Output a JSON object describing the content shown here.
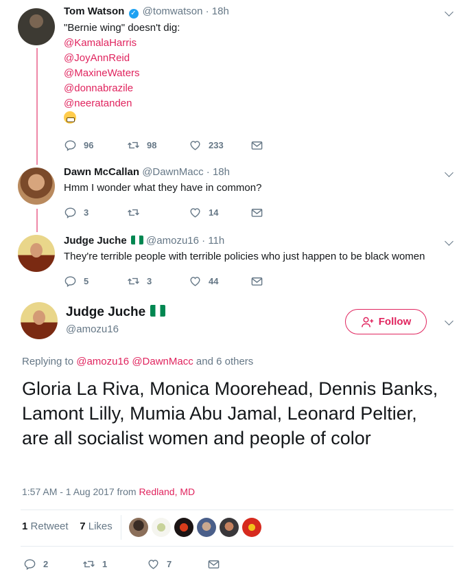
{
  "tweets": [
    {
      "name": "Tom Watson",
      "verified": true,
      "handle": "@tomwatson",
      "time": "18h",
      "text_lines": [
        "\"Bernie wing\" doesn't dig:"
      ],
      "mentions": [
        "@KamalaHarris",
        "@JoyAnnReid",
        "@MaxineWaters",
        "@donnabrazile",
        "@neeratanden"
      ],
      "emoji": "grimacing-face",
      "replies": "96",
      "retweets": "98",
      "likes": "233"
    },
    {
      "name": "Dawn McCallan",
      "handle": "@DawnMacc",
      "time": "18h",
      "text": "Hmm I wonder what they have in common?",
      "replies": "3",
      "retweets": "",
      "likes": "14"
    },
    {
      "name": "Judge Juche",
      "flag": "nigeria-flag",
      "handle": "@amozu16",
      "time": "11h",
      "text": "They're terrible people with terrible policies who just happen to be black women",
      "replies": "5",
      "retweets": "3",
      "likes": "44"
    }
  ],
  "main_tweet": {
    "name": "Judge Juche",
    "handle": "@amozu16",
    "follow_label": "Follow",
    "replying_prefix": "Replying to",
    "replying_handles": "@amozu16 @DawnMacc",
    "replying_suffix": "and 6 others",
    "text": "Gloria La Riva, Monica Moorehead, Dennis Banks, Lamont Lilly, Mumia Abu Jamal, Leonard Peltier, are all socialist women and people of color",
    "timestamp": "1:57 AM - 1 Aug 2017 from",
    "location": "Redland, MD",
    "retweet_count": "1",
    "retweet_label": "Retweet",
    "like_count": "7",
    "like_label": "Likes",
    "replies": "2",
    "retweets": "1",
    "likes": "7"
  },
  "colors": {
    "accent": "#e0245e",
    "muted": "#657786",
    "verified": "#1da1f2"
  }
}
